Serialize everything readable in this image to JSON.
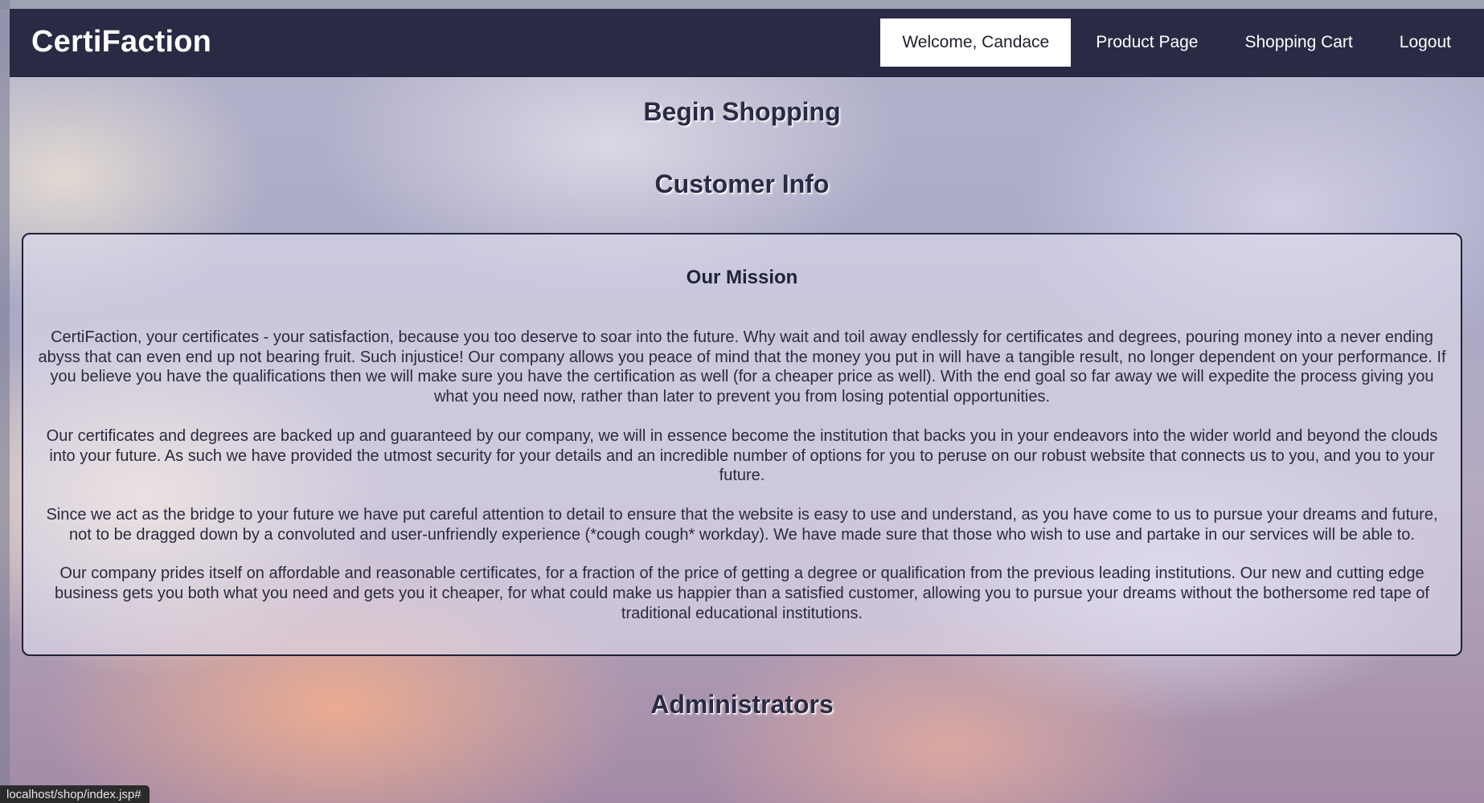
{
  "header": {
    "brand": "CertiFaction",
    "nav": [
      {
        "label": "Welcome, Candace"
      },
      {
        "label": "Product Page"
      },
      {
        "label": "Shopping Cart"
      },
      {
        "label": "Logout"
      }
    ]
  },
  "main": {
    "begin_shopping": "Begin Shopping",
    "customer_info": "Customer Info",
    "mission": {
      "title": "Our Mission",
      "paragraphs": [
        "CertiFaction, your certificates - your satisfaction, because you too deserve to soar into the future. Why wait and toil away endlessly for certificates and degrees, pouring money into a never ending abyss that can even end up not bearing fruit. Such injustice! Our company allows you peace of mind that the money you put in will have a tangible result, no longer dependent on your performance. If you believe you have the qualifications then we will make sure you have the certification as well (for a cheaper price as well). With the end goal so far away we will expedite the process giving you what you need now, rather than later to prevent you from losing potential opportunities.",
        "Our certificates and degrees are backed up and guaranteed by our company, we will in essence become the institution that backs you in your endeavors into the wider world and beyond the clouds into your future. As such we have provided the utmost security for your details and an incredible number of options for you to peruse on our robust website that connects us to you, and you to your future.",
        "Since we act as the bridge to your future we have put careful attention to detail to ensure that the website is easy to use and understand, as you have come to us to pursue your dreams and future, not to be dragged down by a convoluted and user-unfriendly experience (*cough cough* workday). We have made sure that those who wish to use and partake in our services will be able to.",
        "Our company prides itself on affordable and reasonable certificates, for a fraction of the price of getting a degree or qualification from the previous leading institutions. Our new and cutting edge business gets you both what you need and gets you it cheaper, for what could make us happier than a satisfied customer, allowing you to pursue your dreams without the bothersome red tape of traditional educational institutions."
      ]
    },
    "administrators": "Administrators"
  },
  "status_bar": {
    "url": "localhost/shop/index.jsp#"
  }
}
